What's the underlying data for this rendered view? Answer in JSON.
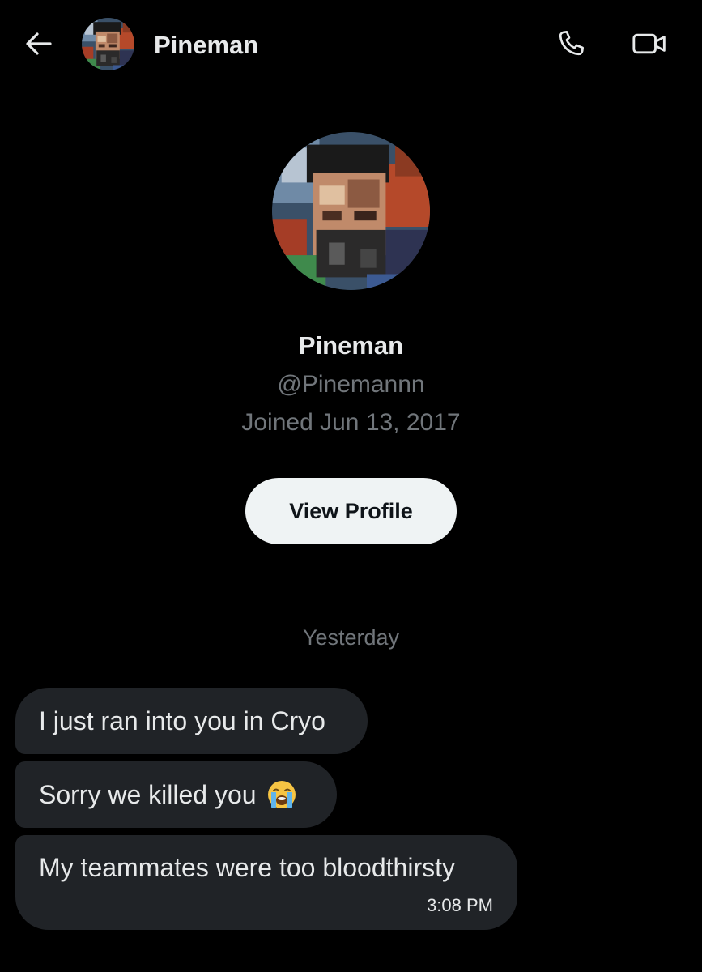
{
  "header": {
    "name": "Pineman"
  },
  "profile": {
    "name": "Pineman",
    "handle": "@Pinemannn",
    "joined": "Joined Jun 13, 2017",
    "view_profile_label": "View Profile"
  },
  "conversation": {
    "date_separator": "Yesterday",
    "messages": [
      {
        "text": "I just ran into you in Cryo"
      },
      {
        "text": "Sorry we killed you",
        "emoji": "loudly-crying-face"
      },
      {
        "text": "My teammates were too bloodthirsty",
        "time": "3:08 PM"
      }
    ]
  },
  "colors": {
    "background": "#000000",
    "bubble": "#202327",
    "primary_text": "#e7e9ea",
    "secondary_text": "#71767b",
    "button_bg": "#eff3f4"
  },
  "icons": {
    "back": "arrow-left-icon",
    "call": "phone-icon",
    "video": "video-camera-icon"
  }
}
